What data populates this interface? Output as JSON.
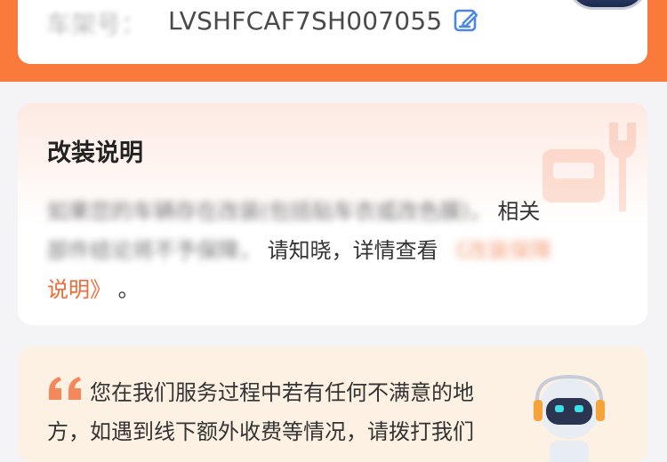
{
  "vin_card": {
    "label": "车架号：",
    "value": "LVSHFCAF7SH007055"
  },
  "modification": {
    "title": "改装说明",
    "body_blurred_1": "如果您的车辆存在改装(包括贴车衣或改色膜)，",
    "body_clear_1": "相关",
    "body_blurred_2": "部件结论将不予保障，",
    "body_clear_2": "请知晓，详情查看",
    "link_blurred": "《改装保障",
    "link_clear": "说明》",
    "body_end": "。"
  },
  "feedback": {
    "text": "您在我们服务过程中若有任何不满意的地方，如遇到线下额外收费等情况，请拨打我们"
  },
  "colors": {
    "brand_orange": "#f97a3a",
    "link_orange": "#f16a35",
    "feedback_bg": "#fdf1e3"
  }
}
